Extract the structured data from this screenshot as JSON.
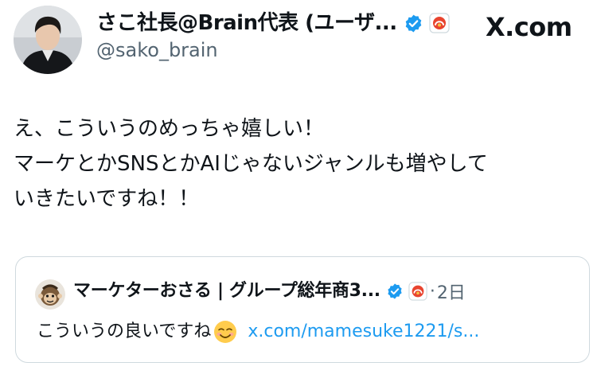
{
  "author": {
    "display_name": "さこ社長@Brain代表 (ユーザ...",
    "handle": "@sako_brain"
  },
  "site_label": "X.com",
  "tweet": {
    "lines": [
      "え、こういうのめっちゃ嬉しい！",
      "マーケとかSNSとかAIじゃないジャンルも増やして",
      "いきたいですね！！"
    ]
  },
  "quoted": {
    "display_name": "マーケターおさる | グループ総年商3...",
    "separator": "·",
    "time": "2日",
    "text": "こういうの良いですね",
    "link": "x.com/mamesuke1221/s..."
  },
  "colors": {
    "text": "#0f1419",
    "secondary": "#536471",
    "link": "#1d9bf0",
    "verified": "#1d9bf0",
    "border": "#cfd9de"
  }
}
